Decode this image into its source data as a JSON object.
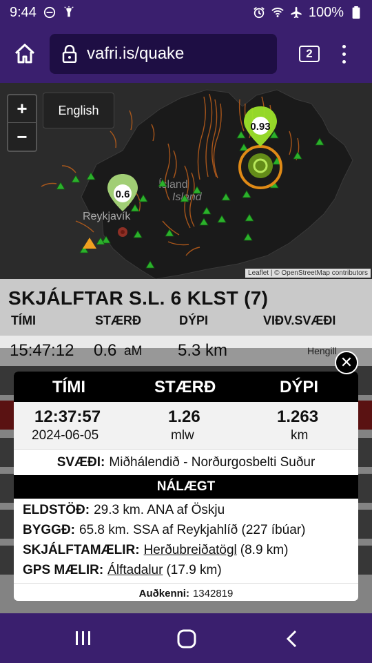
{
  "status_bar": {
    "time": "9:44",
    "battery": "100%",
    "icons": [
      "do-not-disturb-icon",
      "flashlight-icon",
      "alarm-icon",
      "wifi-icon",
      "airplane-icon",
      "battery-icon"
    ]
  },
  "browser": {
    "url": "vafri.is/quake",
    "tab_count": "2"
  },
  "map": {
    "zoom_in": "+",
    "zoom_out": "−",
    "language_button": "English",
    "country_label_1": "Ísland",
    "country_label_2": "Island",
    "city_label": "Reykjavík",
    "marker_1": "0.93",
    "marker_2": "0.6",
    "attribution": "Leaflet | © OpenStreetMap contributors"
  },
  "list": {
    "title": "SKJÁLFTAR S.L. 6 KLST (7)",
    "columns": [
      "TÍMI",
      "STÆRÐ",
      "DÝPI",
      "VIÐV.SVÆÐI"
    ],
    "first_row": {
      "time": "15:47:12",
      "size": "0.6",
      "size_unit": "aM",
      "depth": "5.3 km",
      "area": "Hengill"
    }
  },
  "popup": {
    "headers": [
      "TÍMI",
      "STÆRÐ",
      "DÝPI"
    ],
    "time": "12:37:57",
    "date": "2024-06-05",
    "magnitude": "1.26",
    "magnitude_unit": "mlw",
    "depth": "1.263",
    "depth_unit": "km",
    "area_label": "SVÆÐI:",
    "area": "Miðhálendið - Norðurgosbelti Suður",
    "nearby_title": "NÁLÆGT",
    "volcano_label": "ELDSTÖÐ:",
    "volcano": "29.3 km. ANA af Öskju",
    "town_label": "BYGGÐ:",
    "town": "65.8 km. SSA af Reykjahlíð (227 íbúar)",
    "seismometer_label": "SKJÁLFTAMÆLIR:",
    "seismometer_link": "Herðubreiðatögl",
    "seismometer_dist": "(8.9 km)",
    "gps_label": "GPS MÆLIR:",
    "gps_link": "Álftadalur",
    "gps_dist": "(17.9 km)",
    "id_label": "Auðkenni:",
    "id": "1342819",
    "close": "✕"
  },
  "colors": {
    "system_bar": "#3a1f6e",
    "url_box": "#1e0e44",
    "marker_green": "#9be22a",
    "highlight_orange": "#e08a16",
    "station_green": "#2bb12b",
    "highlight_row_red": "#b01c1c"
  }
}
